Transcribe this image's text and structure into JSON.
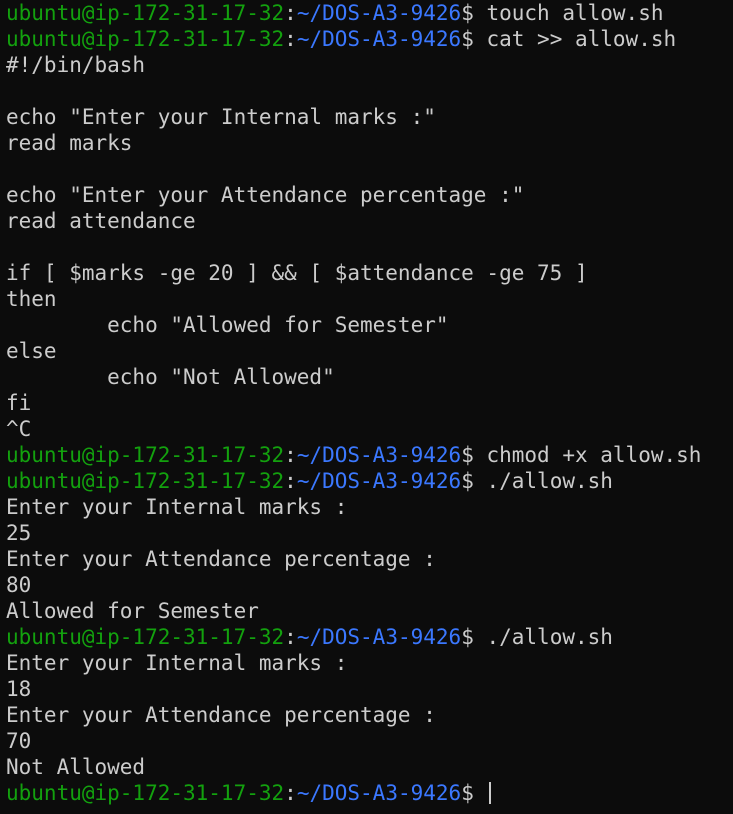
{
  "prompt": {
    "user_host": "ubuntu@ip-172-31-17-32",
    "colon": ":",
    "path": "~/DOS-A3-9426",
    "dollar": "$"
  },
  "lines": [
    {
      "type": "prompt",
      "command": " touch allow.sh"
    },
    {
      "type": "prompt",
      "command": " cat >> allow.sh"
    },
    {
      "type": "text",
      "text": "#!/bin/bash"
    },
    {
      "type": "text",
      "text": ""
    },
    {
      "type": "text",
      "text": "echo \"Enter your Internal marks :\""
    },
    {
      "type": "text",
      "text": "read marks"
    },
    {
      "type": "text",
      "text": ""
    },
    {
      "type": "text",
      "text": "echo \"Enter your Attendance percentage :\""
    },
    {
      "type": "text",
      "text": "read attendance"
    },
    {
      "type": "text",
      "text": ""
    },
    {
      "type": "text",
      "text": "if [ $marks -ge 20 ] && [ $attendance -ge 75 ]"
    },
    {
      "type": "text",
      "text": "then"
    },
    {
      "type": "text",
      "text": "        echo \"Allowed for Semester\""
    },
    {
      "type": "text",
      "text": "else"
    },
    {
      "type": "text",
      "text": "        echo \"Not Allowed\""
    },
    {
      "type": "text",
      "text": "fi"
    },
    {
      "type": "text",
      "text": "^C"
    },
    {
      "type": "prompt",
      "command": " chmod +x allow.sh"
    },
    {
      "type": "prompt",
      "command": " ./allow.sh"
    },
    {
      "type": "text",
      "text": "Enter your Internal marks :"
    },
    {
      "type": "text",
      "text": "25"
    },
    {
      "type": "text",
      "text": "Enter your Attendance percentage :"
    },
    {
      "type": "text",
      "text": "80"
    },
    {
      "type": "text",
      "text": "Allowed for Semester"
    },
    {
      "type": "prompt",
      "command": " ./allow.sh"
    },
    {
      "type": "text",
      "text": "Enter your Internal marks :"
    },
    {
      "type": "text",
      "text": "18"
    },
    {
      "type": "text",
      "text": "Enter your Attendance percentage :"
    },
    {
      "type": "text",
      "text": "70"
    },
    {
      "type": "text",
      "text": "Not Allowed"
    },
    {
      "type": "prompt",
      "command": " ",
      "cursor": true
    }
  ],
  "colors": {
    "background": "#0c0c0c",
    "foreground": "#cccccc",
    "user_host": "#13a10e",
    "path": "#3b78ff"
  }
}
